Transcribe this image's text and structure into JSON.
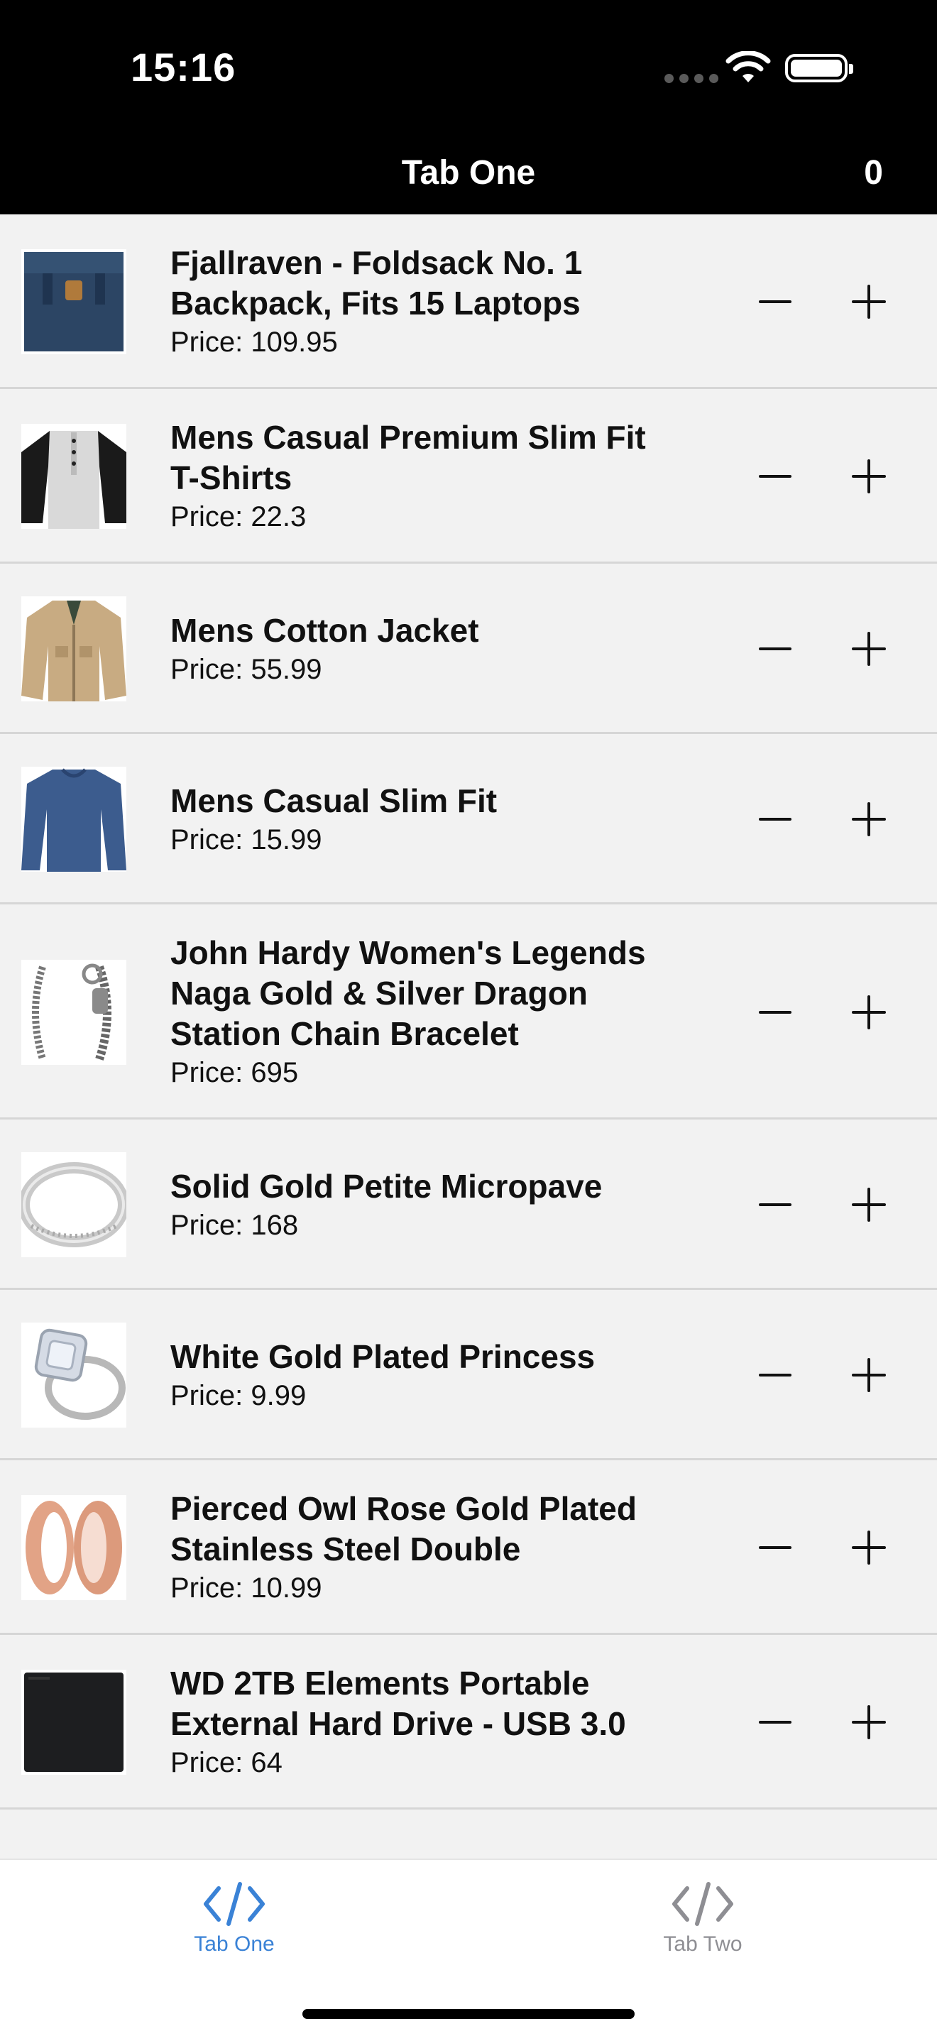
{
  "status_bar": {
    "time": "15:16"
  },
  "nav": {
    "title": "Tab One",
    "cart_count": "0"
  },
  "products": [
    {
      "title_lines": [
        "Fjallraven - Foldsack No. 1",
        "Backpack, Fits 15 Laptops"
      ],
      "price": "Price: 109.95",
      "thumb": "backpack"
    },
    {
      "title_lines": [
        "Mens Casual Premium Slim Fit",
        "T-Shirts"
      ],
      "price": "Price: 22.3",
      "thumb": "tshirt"
    },
    {
      "title_lines": [
        "Mens Cotton Jacket"
      ],
      "price": "Price: 55.99",
      "thumb": "jacket"
    },
    {
      "title_lines": [
        "Mens Casual Slim Fit"
      ],
      "price": "Price: 15.99",
      "thumb": "longsleeve"
    },
    {
      "title_lines": [
        "John Hardy Women's Legends",
        "Naga Gold & Silver Dragon",
        "Station Chain Bracelet"
      ],
      "price": "Price: 695",
      "thumb": "bracelet"
    },
    {
      "title_lines": [
        "Solid Gold Petite Micropave"
      ],
      "price": "Price: 168",
      "thumb": "ring-band"
    },
    {
      "title_lines": [
        "White Gold Plated Princess"
      ],
      "price": "Price: 9.99",
      "thumb": "ring-diamond"
    },
    {
      "title_lines": [
        "Pierced Owl Rose Gold Plated",
        "Stainless Steel Double"
      ],
      "price": "Price: 10.99",
      "thumb": "plugs"
    },
    {
      "title_lines": [
        "WD 2TB Elements Portable",
        "External Hard Drive - USB 3.0"
      ],
      "price": "Price: 64",
      "thumb": "harddrive"
    }
  ],
  "tabs": [
    {
      "label": "Tab One",
      "icon": "code-icon",
      "active": true
    },
    {
      "label": "Tab Two",
      "icon": "code-icon",
      "active": false
    }
  ],
  "colors": {
    "accent": "#3a82d6",
    "inactive": "#8e8e93",
    "header_bg": "#000000",
    "list_bg": "#f2f2f2"
  }
}
